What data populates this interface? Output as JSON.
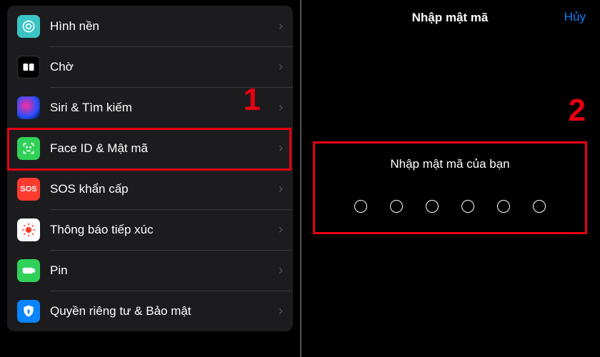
{
  "annotations": {
    "left": "1",
    "right": "2"
  },
  "settings": {
    "items": [
      {
        "key": "wallpaper",
        "label": "Hình nền",
        "icon": "wallpaper-icon"
      },
      {
        "key": "standby",
        "label": "Chờ",
        "icon": "standby-icon"
      },
      {
        "key": "siri",
        "label": "Siri & Tìm kiếm",
        "icon": "siri-icon"
      },
      {
        "key": "faceid",
        "label": "Face ID & Mật mã",
        "icon": "faceid-icon"
      },
      {
        "key": "sos",
        "label": "SOS khẩn cấp",
        "icon": "sos-icon"
      },
      {
        "key": "exposure",
        "label": "Thông báo tiếp xúc",
        "icon": "exposure-icon"
      },
      {
        "key": "battery",
        "label": "Pin",
        "icon": "battery-icon"
      },
      {
        "key": "privacy",
        "label": "Quyền riêng tư & Bảo mật",
        "icon": "privacy-icon"
      }
    ]
  },
  "passcode": {
    "title": "Nhập mật mã",
    "cancel": "Hủy",
    "prompt": "Nhập mật mã của bạn",
    "digits": 6
  },
  "colors": {
    "highlight": "#e60012",
    "link": "#0a84ff"
  }
}
